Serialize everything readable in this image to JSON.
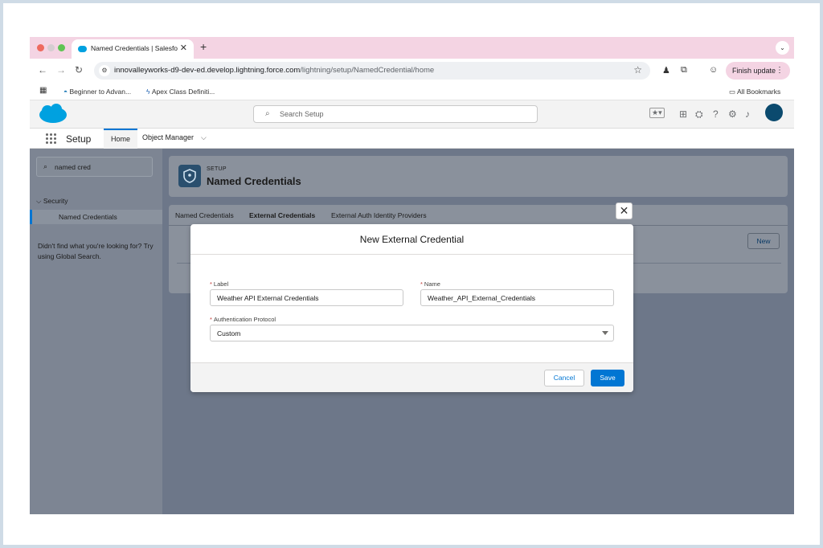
{
  "browser": {
    "tab_title": "Named Credentials | Salesforce",
    "new_tab": "+",
    "url_host": "innovalleyworks-d9-dev-ed.develop.lightning.force.com",
    "url_path": "/lightning/setup/NamedCredential/home",
    "finish_update": "Finish update",
    "bookmarks": [
      "Beginner to Advan...",
      "Apex Class Definiti..."
    ],
    "all_bookmarks": "All Bookmarks"
  },
  "header": {
    "search_placeholder": "Search Setup",
    "brand_color": "#00a1e0"
  },
  "setup_nav": {
    "title": "Setup",
    "home": "Home",
    "object_manager": "Object Manager"
  },
  "sidebar": {
    "quick_find_value": "named cred",
    "section": "Security",
    "item": "Named Credentials",
    "hint": "Didn't find what you're looking for? Try using Global Search."
  },
  "page": {
    "breadcrumb": "SETUP",
    "title": "Named Credentials",
    "tabs": [
      "Named Credentials",
      "External Credentials",
      "External Auth Identity Providers"
    ],
    "new_button": "New"
  },
  "modal": {
    "title": "New External Credential",
    "label_field": {
      "label": "Label",
      "value": "Weather API External Credentials"
    },
    "name_field": {
      "label": "Name",
      "value": "Weather_API_External_Credentials"
    },
    "protocol_field": {
      "label": "Authentication Protocol",
      "value": "Custom"
    },
    "required_mark": "*",
    "cancel": "Cancel",
    "save": "Save",
    "close": "✕"
  }
}
